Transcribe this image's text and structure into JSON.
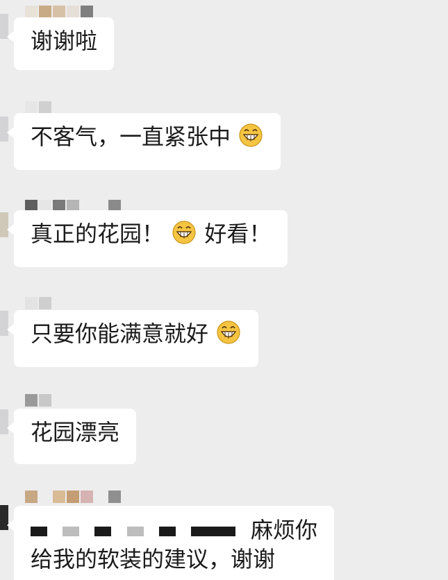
{
  "messages": [
    {
      "text": "谢谢啦",
      "emoji_after": false
    },
    {
      "text": "不客气，一直紧张中",
      "emoji_after": true
    },
    {
      "text_before": "真正的花园！",
      "text_after": "好看！"
    },
    {
      "text": "只要你能满意就好",
      "emoji_after": true
    },
    {
      "text": "花园漂亮",
      "emoji_after": false
    },
    {
      "line1_visible": "麻烦你",
      "line2": "给我的软装的建议，谢谢"
    }
  ],
  "emoji": "grinning-face-icon",
  "colors": {
    "background": "#ededee",
    "bubble": "#ffffff",
    "text": "#1b1b1b",
    "emoji_fill": "#f5c542"
  }
}
